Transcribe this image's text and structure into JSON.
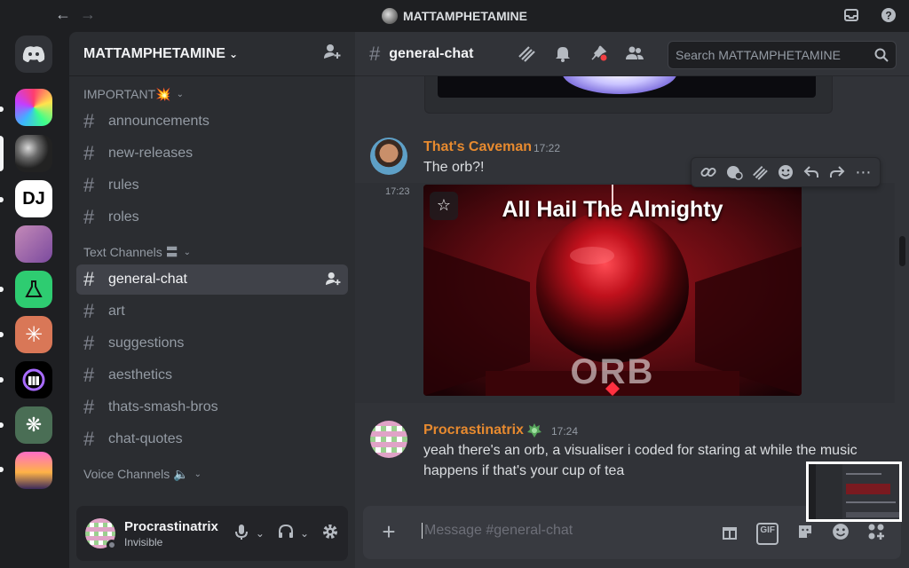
{
  "window": {
    "title": "MATTAMPHETAMINE"
  },
  "server": {
    "name": "MATTAMPHETAMINE"
  },
  "categories": [
    {
      "label": "IMPORTANT💥"
    },
    {
      "label": "Text Channels 〓"
    },
    {
      "label": "Voice Channels 🔈"
    }
  ],
  "channels": [
    {
      "label": "announcements"
    },
    {
      "label": "new-releases"
    },
    {
      "label": "rules"
    },
    {
      "label": "roles"
    },
    {
      "label": "general-chat"
    },
    {
      "label": "art"
    },
    {
      "label": "suggestions"
    },
    {
      "label": "aesthetics"
    },
    {
      "label": "thats-smash-bros"
    },
    {
      "label": "chat-quotes"
    }
  ],
  "rail": {
    "dj_label": "DJ"
  },
  "user": {
    "name": "Procrastinatrix",
    "status": "Invisible"
  },
  "chat": {
    "channel": "general-chat",
    "search_placeholder": "Search MATTAMPHETAMINE",
    "composer_placeholder": "Message #general-chat",
    "gif_label": "GIF"
  },
  "messages": [
    {
      "author": "That's Caveman",
      "time": "17:22",
      "text": "The orb?!",
      "followup_time": "17:23",
      "embed_title": "All Hail The Almighty",
      "embed_word": "ORB"
    },
    {
      "author": "Procrastinatrix",
      "time": "17:24",
      "text_line1": "yeah there's an orb, a visualiser i coded for staring at while the music",
      "text_line2": "happens if that's your cup of tea"
    }
  ],
  "colors": {
    "accent_author": "#e78a2f",
    "background_chat": "#313338",
    "background_sidebar": "#2b2d31",
    "background_rail": "#1e1f22",
    "active_channel": "#404249"
  }
}
